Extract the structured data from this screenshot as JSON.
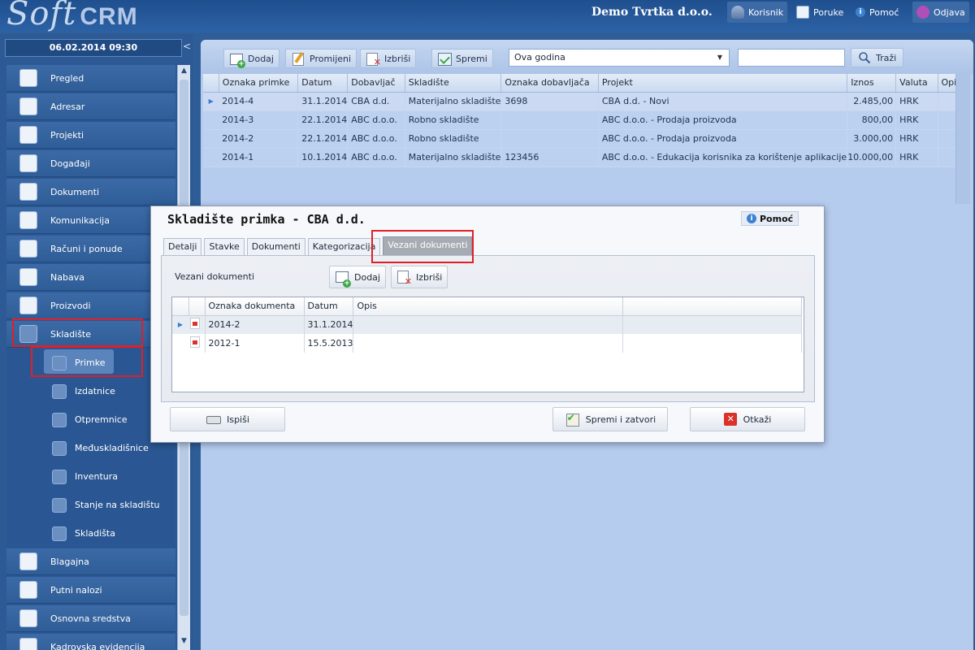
{
  "app": {
    "logo_soft": "Soft",
    "logo_crm": "CRM",
    "company": "Demo Tvrtka d.o.o."
  },
  "topnav": {
    "korisnik": "Korisnik",
    "poruke": "Poruke",
    "pomoc": "Pomoć",
    "odjava": "Odjava"
  },
  "sidebar": {
    "datetime": "06.02.2014 09:30",
    "collapse": "<",
    "items": [
      {
        "label": "Pregled",
        "icon": "chart-icon"
      },
      {
        "label": "Adresar",
        "icon": "address-book-icon"
      },
      {
        "label": "Projekti",
        "icon": "projects-icon"
      },
      {
        "label": "Događaji",
        "icon": "calendar-icon"
      },
      {
        "label": "Dokumenti",
        "icon": "documents-icon"
      },
      {
        "label": "Komunikacija",
        "icon": "communication-icon"
      },
      {
        "label": "Računi i ponude",
        "icon": "invoice-icon"
      },
      {
        "label": "Nabava",
        "icon": "purchase-icon"
      },
      {
        "label": "Proizvodi",
        "icon": "products-icon"
      },
      {
        "label": "Skladište",
        "icon": "warehouse-icon"
      }
    ],
    "subitems": [
      {
        "label": "Primke",
        "icon": "receipt-icon"
      },
      {
        "label": "Izdatnice",
        "icon": "issue-icon"
      },
      {
        "label": "Otpremnice",
        "icon": "delivery-icon"
      },
      {
        "label": "Međuskladišnice",
        "icon": "transfer-icon"
      },
      {
        "label": "Inventura",
        "icon": "inventory-icon"
      },
      {
        "label": "Stanje na skladištu",
        "icon": "stock-icon"
      },
      {
        "label": "Skladišta",
        "icon": "warehouses-icon"
      }
    ],
    "items_after": [
      {
        "label": "Blagajna",
        "icon": "cash-icon"
      },
      {
        "label": "Putni nalozi",
        "icon": "travel-icon"
      },
      {
        "label": "Osnovna sredstva",
        "icon": "assets-icon"
      },
      {
        "label": "Kadrovska evidencija",
        "icon": "hr-icon"
      }
    ]
  },
  "toolbar": {
    "dodaj": "Dodaj",
    "promijeni": "Promijeni",
    "izbrisi": "Izbriši",
    "spremi": "Spremi",
    "period": "Ova godina",
    "search_value": "",
    "trazi": "Traži"
  },
  "grid": {
    "columns": [
      "Oznaka primke",
      "Datum",
      "Dobavljač",
      "Skladište",
      "Oznaka dobavljača",
      "Projekt",
      "Iznos",
      "Valuta",
      "Opis"
    ],
    "rows": [
      [
        "2014-4",
        "31.1.2014",
        "CBA d.d.",
        "Materijalno skladište",
        "3698",
        "CBA d.d. - Novi",
        "2.485,00",
        "HRK",
        ""
      ],
      [
        "2014-3",
        "22.1.2014",
        "ABC d.o.o.",
        "Robno skladište",
        "",
        "ABC d.o.o. - Prodaja proizvoda",
        "800,00",
        "HRK",
        ""
      ],
      [
        "2014-2",
        "22.1.2014",
        "ABC d.o.o.",
        "Robno skladište",
        "",
        "ABC d.o.o. - Prodaja proizvoda",
        "3.000,00",
        "HRK",
        ""
      ],
      [
        "2014-1",
        "10.1.2014",
        "ABC d.o.o.",
        "Materijalno skladište",
        "123456",
        "ABC d.o.o. - Edukacija korisnika za korištenje aplikacije",
        "10.000,00",
        "HRK",
        ""
      ]
    ]
  },
  "modal": {
    "title": "Skladište primka - CBA d.d.",
    "help": "Pomoć",
    "tabs": [
      "Detalji",
      "Stavke",
      "Dokumenti",
      "Kategorizacija",
      "Vezani dokumenti"
    ],
    "section_label": "Vezani dokumenti",
    "dodaj": "Dodaj",
    "izbrisi": "Izbriši",
    "columns": [
      "Oznaka dokumenta",
      "Datum",
      "Opis"
    ],
    "rows": [
      [
        "2014-2",
        "31.1.2014",
        ""
      ],
      [
        "2012-1",
        "15.5.2013",
        ""
      ]
    ],
    "ispisi": "Ispiši",
    "spremi_zatvori": "Spremi i zatvori",
    "otkazi": "Otkaži"
  },
  "colors": {
    "highlight": "#e01f26",
    "accent": "#2f5d97"
  }
}
